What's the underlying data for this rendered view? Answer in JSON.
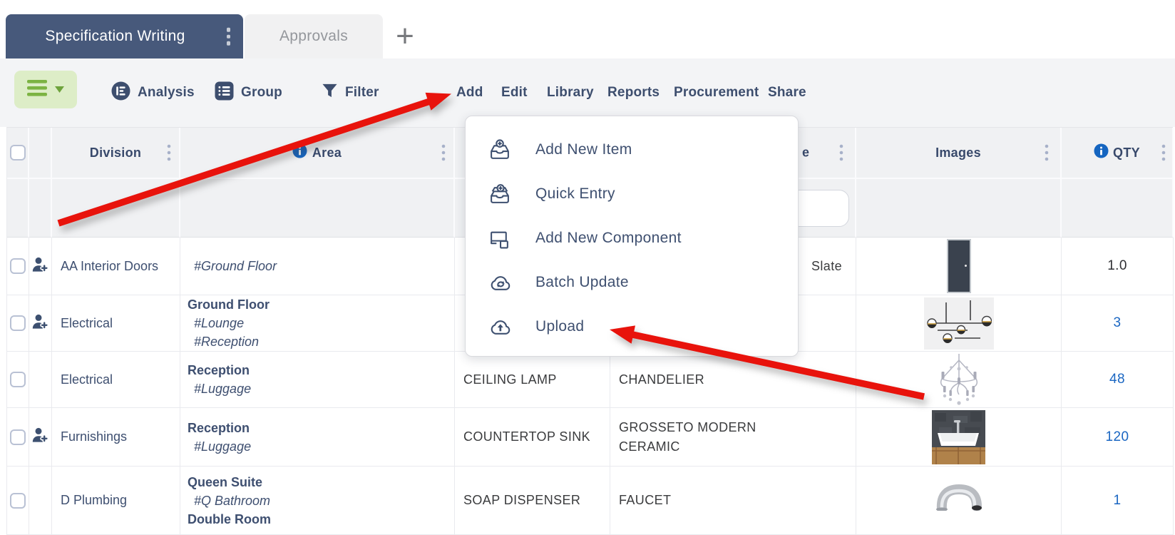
{
  "tab_bar": {
    "active_tab": "Specification Writing",
    "inactive_tab": "Approvals",
    "new_tab": "+"
  },
  "toolbar": {
    "analysis_label": "Analysis",
    "group_label": "Group",
    "filter_label": "Filter",
    "menu_items": [
      "Add",
      "Edit",
      "Library",
      "Reports",
      "Procurement",
      "Share"
    ]
  },
  "add_menu": {
    "items": [
      {
        "label": "Add New Item",
        "icon": "add-new-item-tray-icon"
      },
      {
        "label": "Quick Entry",
        "icon": "quick-entry-tray-icon"
      },
      {
        "label": "Add New Component",
        "icon": "component-icon"
      },
      {
        "label": "Batch Update",
        "icon": "batch-update-cloud-icon"
      },
      {
        "label": "Upload",
        "icon": "upload-cloud-icon"
      }
    ]
  },
  "table": {
    "headers": {
      "division": "Division",
      "area": "Area",
      "type_visible_fragment": "e",
      "images": "Images",
      "qty": "QTY"
    },
    "rows": [
      {
        "division": "AA Interior Doors",
        "area_lines": [
          {
            "text": "#Ground Floor",
            "style": "tag"
          }
        ],
        "item": "",
        "type_text": "Slate",
        "qty": "1.0",
        "qty_is_link": false,
        "assign_icon": true,
        "image": "dark-door"
      },
      {
        "division": "Electrical",
        "area_lines": [
          {
            "text": "Ground Floor",
            "style": "bold"
          },
          {
            "text": "#Lounge",
            "style": "tag"
          },
          {
            "text": "#Reception",
            "style": "tag"
          }
        ],
        "item": "",
        "type_text": "",
        "qty": "3",
        "qty_is_link": true,
        "assign_icon": true,
        "image": "pendant-light"
      },
      {
        "division": "Electrical",
        "area_lines": [
          {
            "text": "Reception",
            "style": "bold"
          },
          {
            "text": "#Luggage",
            "style": "tag"
          }
        ],
        "item": "CEILING LAMP",
        "type_text": "CHANDELIER",
        "qty": "48",
        "qty_is_link": true,
        "assign_icon": false,
        "image": "chandelier"
      },
      {
        "division": "Furnishings",
        "area_lines": [
          {
            "text": "Reception",
            "style": "bold"
          },
          {
            "text": "#Luggage",
            "style": "tag"
          }
        ],
        "item": "COUNTERTOP SINK",
        "type_text": "GROSSETO MODERN CERAMIC",
        "qty": "120",
        "qty_is_link": true,
        "assign_icon": true,
        "image": "countertop-sink"
      },
      {
        "division": "D Plumbing",
        "area_lines": [
          {
            "text": "Queen Suite",
            "style": "bold"
          },
          {
            "text": "#Q Bathroom",
            "style": "tag"
          },
          {
            "text": "Double Room",
            "style": "bold"
          }
        ],
        "item": "SOAP DISPENSER",
        "type_text": "FAUCET",
        "qty": "1",
        "qty_is_link": true,
        "assign_icon": false,
        "image": "faucet"
      }
    ]
  },
  "colors": {
    "tab_dark": "#47597b",
    "accent_green": "#7cb342",
    "green_button_bg": "#ddedc7",
    "navy_text": "#3e4f70",
    "info_blue": "#1565c0",
    "qty_link_blue": "#1a66c2",
    "arrow_red": "#e8130c"
  }
}
